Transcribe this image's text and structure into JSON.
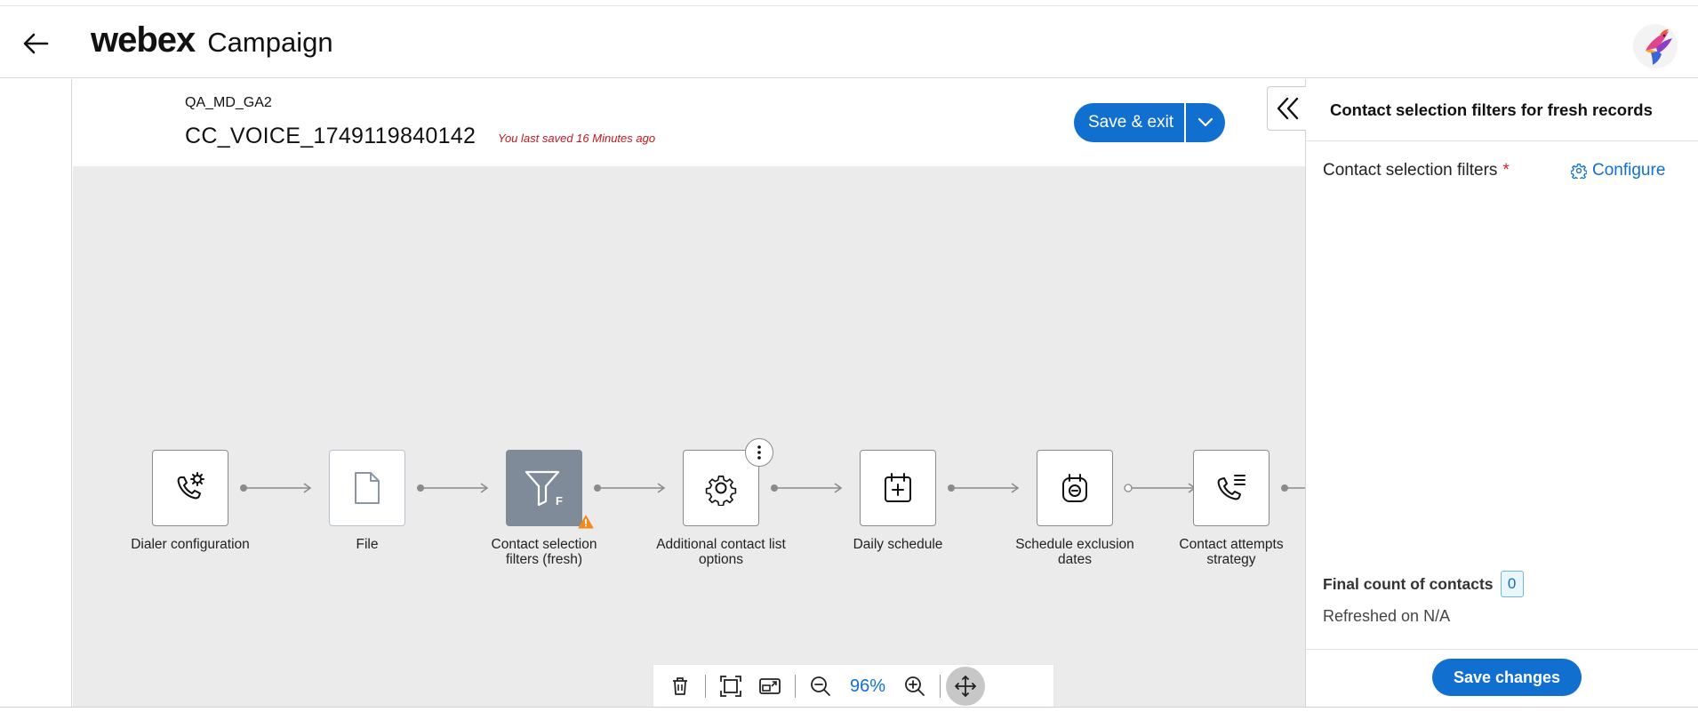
{
  "header": {
    "brand_logo": "webex",
    "product_name": "Campaign"
  },
  "campaign": {
    "org_name": "QA_MD_GA2",
    "name": "CC_VOICE_1749119840142",
    "last_saved": "You last saved 16 Minutes ago",
    "save_exit_label": "Save & exit"
  },
  "flow": {
    "nodes": [
      {
        "label": "Dialer configuration",
        "icon": "phone-gear-icon"
      },
      {
        "label": "File",
        "icon": "file-icon"
      },
      {
        "label": "Contact selection filters (fresh)",
        "icon": "filter-icon",
        "badge": "F",
        "selected": true,
        "warning": true
      },
      {
        "label": "Additional contact list options",
        "icon": "gear-icon"
      },
      {
        "label": "Daily schedule",
        "icon": "calendar-plus-icon"
      },
      {
        "label": "Schedule exclusion dates",
        "icon": "calendar-minus-icon"
      },
      {
        "label": "Contact attempts strategy",
        "icon": "phone-list-icon"
      }
    ]
  },
  "toolbar": {
    "zoom": "96%"
  },
  "panel": {
    "title": "Contact selection filters for fresh records",
    "filters_label": "Contact selection filters",
    "required_marker": "*",
    "configure_label": "Configure",
    "final_count_label": "Final count of contacts",
    "final_count_value": "0",
    "refreshed_label": "Refreshed on N/A",
    "save_changes_label": "Save changes"
  },
  "colors": {
    "accent": "#1170cf",
    "warning": "#f08a1d",
    "error_text": "#c4161c",
    "canvas_bg": "#ebebeb",
    "selected_node": "#7f8b99"
  }
}
